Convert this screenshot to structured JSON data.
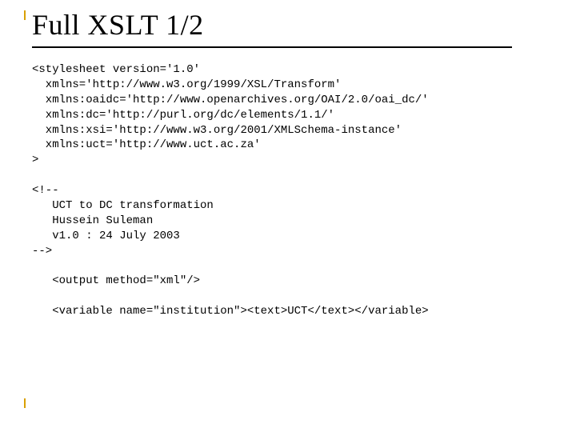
{
  "title": "Full XSLT 1/2",
  "code": "<stylesheet version='1.0'\n  xmlns='http://www.w3.org/1999/XSL/Transform'\n  xmlns:oaidc='http://www.openarchives.org/OAI/2.0/oai_dc/'\n  xmlns:dc='http://purl.org/dc/elements/1.1/'\n  xmlns:xsi='http://www.w3.org/2001/XMLSchema-instance'\n  xmlns:uct='http://www.uct.ac.za'\n>\n\n<!--\n   UCT to DC transformation\n   Hussein Suleman\n   v1.0 : 24 July 2003\n-->\n\n   <output method=\"xml\"/>\n\n   <variable name=\"institution\"><text>UCT</text></variable>"
}
